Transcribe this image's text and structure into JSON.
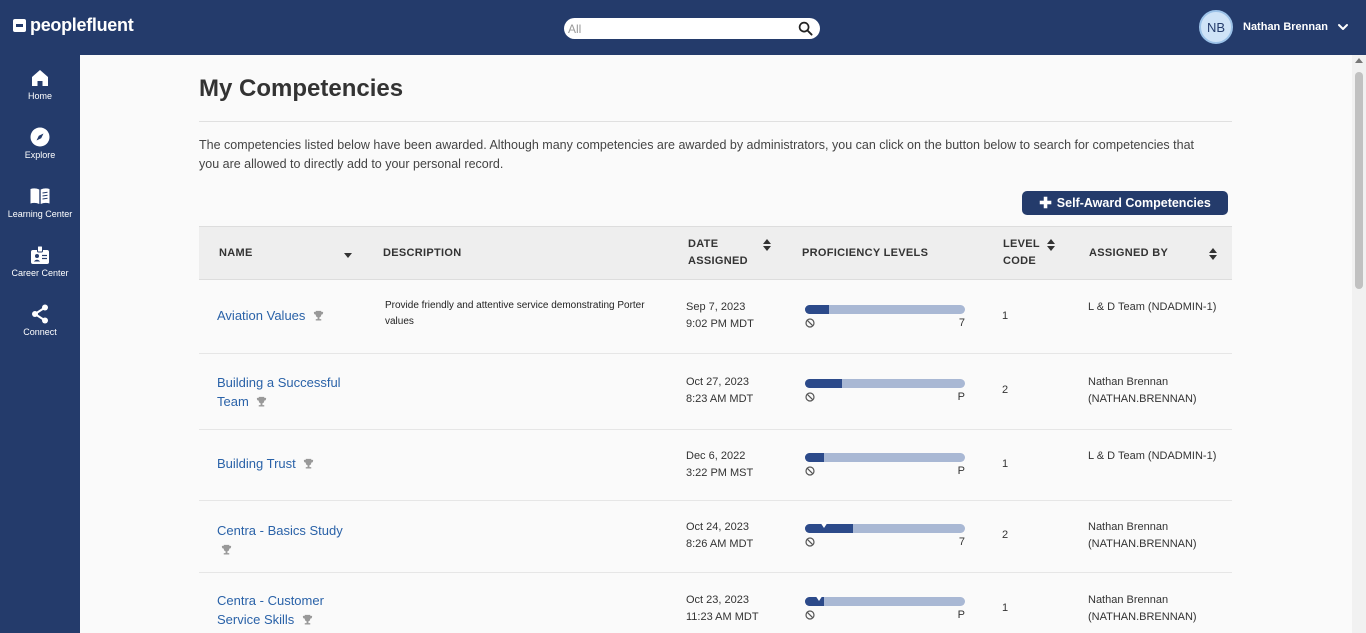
{
  "app": {
    "logo_text": "peoplefluent"
  },
  "search": {
    "placeholder": "All"
  },
  "user": {
    "initials": "NB",
    "name": "Nathan Brennan"
  },
  "sidebar": {
    "items": [
      {
        "label": "Home",
        "icon": "home-icon"
      },
      {
        "label": "Explore",
        "icon": "compass-icon"
      },
      {
        "label": "Learning Center",
        "icon": "book-icon"
      },
      {
        "label": "Career Center",
        "icon": "badge-icon"
      },
      {
        "label": "Connect",
        "icon": "share-icon"
      }
    ]
  },
  "page": {
    "title": "My Competencies",
    "intro": "The competencies listed below have been awarded. Although many competencies are awarded by administrators, you can click on the button below to search for competencies that you are allowed to directly add to your personal record.",
    "self_award_label": "Self-Award Competencies"
  },
  "table": {
    "headers": {
      "name": "NAME",
      "description": "DESCRIPTION",
      "date_line1": "DATE",
      "date_line2": "ASSIGNED",
      "proficiency": "PROFICIENCY LEVELS",
      "level_line1": "LEVEL",
      "level_line2": "CODE",
      "assigned_by": "ASSIGNED BY"
    },
    "rows": [
      {
        "name": "Aviation Values",
        "description": "Provide friendly and attentive service demonstrating Porter values",
        "date": "Sep 7, 2023",
        "time": "9:02 PM MDT",
        "proficiency_fraction": 0.15,
        "marker_fraction": null,
        "max_level": "7",
        "level_code": "1",
        "assigned_by": "L & D Team (NDADMIN-1)"
      },
      {
        "name": "Building a Successful Team",
        "description": "",
        "date": "Oct 27, 2023",
        "time": "8:23 AM MDT",
        "proficiency_fraction": 0.23,
        "marker_fraction": null,
        "max_level": "P",
        "level_code": "2",
        "assigned_by": "Nathan Brennan (NATHAN.BRENNAN)"
      },
      {
        "name": "Building Trust",
        "description": "",
        "date": "Dec 6, 2022",
        "time": "3:22 PM MST",
        "proficiency_fraction": 0.12,
        "marker_fraction": null,
        "max_level": "P",
        "level_code": "1",
        "assigned_by": "L & D Team (NDADMIN-1)"
      },
      {
        "name": "Centra - Basics Study",
        "description": "",
        "date": "Oct 24, 2023",
        "time": "8:26 AM MDT",
        "proficiency_fraction": 0.3,
        "marker_fraction": 0.12,
        "max_level": "7",
        "level_code": "2",
        "assigned_by": "Nathan Brennan (NATHAN.BRENNAN)"
      },
      {
        "name": "Centra - Customer Service Skills",
        "description": "",
        "date": "Oct 23, 2023",
        "time": "11:23 AM MDT",
        "proficiency_fraction": 0.12,
        "marker_fraction": 0.09,
        "max_level": "P",
        "level_code": "1",
        "assigned_by": "Nathan Brennan (NATHAN.BRENNAN)"
      }
    ]
  },
  "colors": {
    "nav_bg": "#243b6b",
    "link": "#2a62a8",
    "bar_fill": "#2c4a8a",
    "bar_track": "#a9b8d4"
  }
}
